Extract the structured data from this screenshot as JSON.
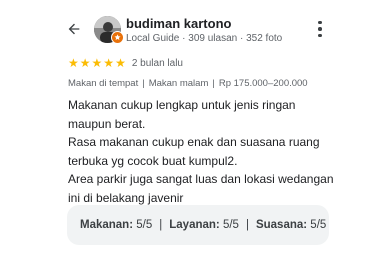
{
  "reviewer": {
    "name": "budiman kartono",
    "meta": "Local Guide · 309 ulasan · 352 foto"
  },
  "review": {
    "rating": 5,
    "rating_max": 5,
    "star_color": "#fbbc04",
    "time": "2 bulan lalu",
    "tags": [
      "Makan di tempat",
      "Makan malam",
      "Rp 175.000–200.000"
    ],
    "text_lines": [
      "Makanan cukup lengkap untuk jenis ringan",
      "maupun berat.",
      "Rasa makanan cukup enak dan suasana ruang",
      "terbuka yg cocok buat kumpul2.",
      "Area parkir juga sangat luas dan lokasi wedangan",
      "ini di belakang javenir"
    ]
  },
  "summary": {
    "food_label": "Makanan:",
    "food_value": "5/5",
    "service_label": "Layanan:",
    "service_value": "5/5",
    "atmosphere_label": "Suasana:",
    "atmosphere_value": "5/5"
  },
  "icons": {
    "back": "arrow-back-icon",
    "menu": "more-vert-icon",
    "badge": "local-guide-badge-icon"
  }
}
